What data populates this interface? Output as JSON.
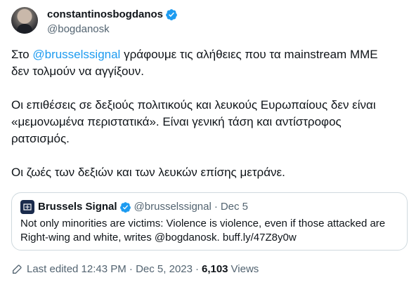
{
  "author": {
    "display_name": "constantinosbogdanos",
    "handle": "@bogdanosk"
  },
  "tweet": {
    "p1_before": "Στο ",
    "p1_mention": "@brusselssignal",
    "p1_after": " γράφουμε τις αλήθειες που τα mainstream ΜΜΕ δεν τολμούν να αγγίξουν.",
    "p2": "Οι επιθέσεις σε δεξιούς πολιτικούς και λευκούς Ευρωπαίους δεν είναι «μεμονωμένα περιστατικά». Είναι γενική τάση και αντίστροφος ρατσισμός.",
    "p3": "Οι ζωές των δεξιών και των λευκών επίσης μετράνε."
  },
  "quote": {
    "name": "Brussels Signal",
    "handle": "@brusselssignal",
    "dot": "·",
    "date": "Dec 5",
    "text": "Not only minorities are victims: Violence is violence, even if those attacked are Right-wing and white, writes @bogdanosk. buff.ly/47Z8y0w"
  },
  "meta": {
    "edited_label": "Last edited 12:43 PM · Dec 5, 2023",
    "sep": "·",
    "views_count": "6,103",
    "views_label": "Views"
  },
  "icons": {
    "verified": "verified-badge-icon",
    "edit": "pencil-icon"
  },
  "colors": {
    "accent": "#1d9bf0",
    "text": "#0f1419",
    "secondary": "#536471",
    "border": "#cfd9de"
  }
}
